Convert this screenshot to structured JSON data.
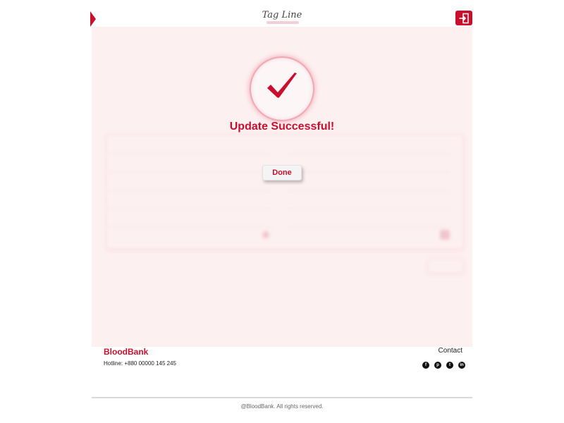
{
  "header": {
    "tagline": "Tag Line",
    "logout_icon": "logout-icon"
  },
  "modal": {
    "icon": "checkmark-icon",
    "title": "Update Successful!",
    "done_label": "Done"
  },
  "colors": {
    "brand": "#c8102e",
    "overlay_bg": "#fdf0f1",
    "footer_text": "#222222"
  },
  "footer": {
    "brand": "BloodBank",
    "hotline": "Hotline: +880 00000 145 245",
    "contact_label": "Contact",
    "socials": [
      {
        "name": "facebook-icon",
        "glyph": "f"
      },
      {
        "name": "pinterest-icon",
        "glyph": "p"
      },
      {
        "name": "twitter-icon",
        "glyph": "t"
      },
      {
        "name": "linkedin-icon",
        "glyph": "in"
      }
    ],
    "copyright": "@BloodBank. All rights reserved."
  }
}
